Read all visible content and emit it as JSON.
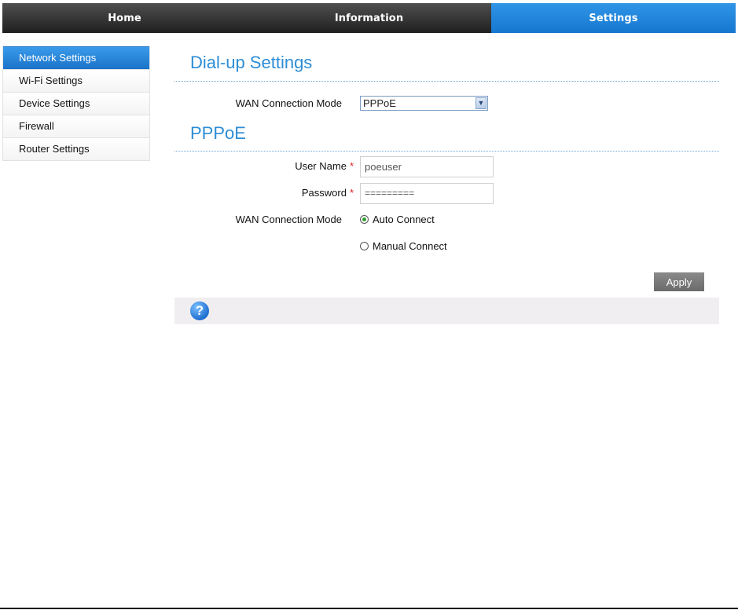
{
  "nav": {
    "tabs": [
      {
        "label": "Home"
      },
      {
        "label": "Information"
      },
      {
        "label": "Settings"
      }
    ],
    "active_color": "#1a7ad4"
  },
  "sidebar": {
    "items": [
      {
        "label": "Network Settings"
      },
      {
        "label": "Wi-Fi Settings"
      },
      {
        "label": "Device Settings"
      },
      {
        "label": "Firewall"
      },
      {
        "label": "Router Settings"
      }
    ]
  },
  "dialup": {
    "title": "Dial-up Settings",
    "wan_mode_label": "WAN Connection Mode",
    "wan_mode_value": "PPPoE"
  },
  "pppoe": {
    "title": "PPPoE",
    "username_label": "User Name",
    "username_value": "poeuser",
    "password_label": "Password",
    "password_value": "=========",
    "required_mark": "*",
    "wan_mode_label": "WAN Connection Mode",
    "option_auto": "Auto Connect",
    "option_manual": "Manual Connect"
  },
  "actions": {
    "apply_label": "Apply"
  },
  "help": {
    "icon_glyph": "?"
  }
}
